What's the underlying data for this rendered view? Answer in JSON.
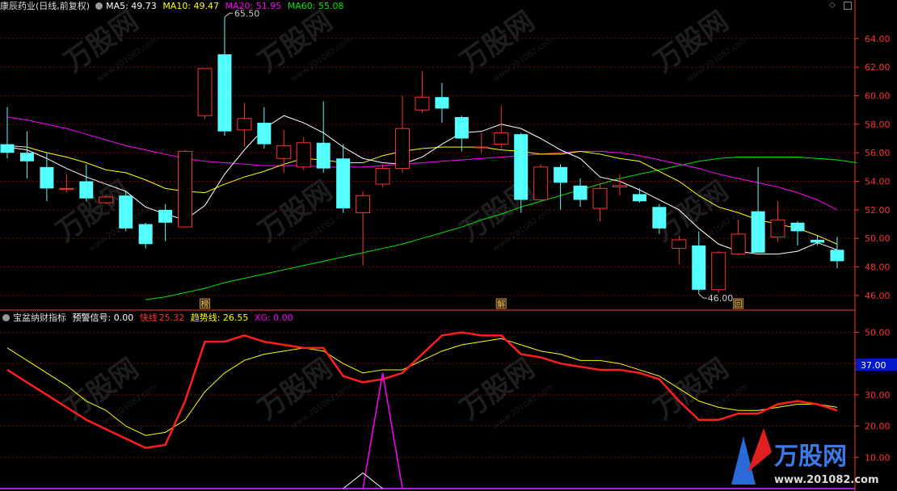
{
  "header": {
    "stock": "康辰药业(日线,前复权)",
    "ma5": "MA5: 49.73",
    "ma10": "MA10: 49.47",
    "ma20": "MA20: 51.95",
    "ma60": "MA60: 55.08"
  },
  "indicator_header": {
    "name": "宝盆纳财指标",
    "warn": "预警信号: 0.00",
    "fast_label": "快线",
    "fast_value": "25.32",
    "trend": "趋势线: 26.55",
    "xg": "XG: 0.00"
  },
  "colors": {
    "up": "#ff3232",
    "down": "#54ffff",
    "ma5": "#ffffff",
    "ma10": "#ffff00",
    "ma20": "#ff00ff",
    "ma60": "#00e600",
    "grid": "#8b0000",
    "axis": "#ff3232"
  },
  "markers": {
    "high_label": "65.50",
    "low_label": "46.00",
    "bang": "榜",
    "jie": "解",
    "hui": "回"
  },
  "watermark": {
    "text": "万股网",
    "url": "www.201082.com"
  },
  "chart_data": [
    {
      "type": "candlestick",
      "yticks": [
        46,
        48,
        50,
        52,
        54,
        56,
        58,
        60,
        62,
        64
      ],
      "ytick_labels": [
        "46.00",
        "48.00",
        "50.00",
        "52.00",
        "54.00",
        "56.00",
        "58.00",
        "60.00",
        "62.00",
        "64.00"
      ],
      "ylim": [
        45.2,
        65.8
      ],
      "candles": [
        {
          "o": 56.6,
          "c": 56.0,
          "h": 59.2,
          "l": 55.6
        },
        {
          "o": 56.0,
          "c": 55.4,
          "h": 57.5,
          "l": 54.2
        },
        {
          "o": 55.0,
          "c": 53.5,
          "h": 56.0,
          "l": 52.6
        },
        {
          "o": 53.5,
          "c": 53.5,
          "h": 54.5,
          "l": 53.2
        },
        {
          "o": 54.0,
          "c": 52.8,
          "h": 55.2,
          "l": 52.6
        },
        {
          "o": 52.5,
          "c": 52.9,
          "h": 53.0,
          "l": 52.4
        },
        {
          "o": 53.0,
          "c": 50.7,
          "h": 53.3,
          "l": 50.5
        },
        {
          "o": 51.0,
          "c": 49.6,
          "h": 51.1,
          "l": 49.3
        },
        {
          "o": 52.0,
          "c": 51.1,
          "h": 52.4,
          "l": 49.8
        },
        {
          "o": 50.8,
          "c": 56.1,
          "h": 56.2,
          "l": 50.8
        },
        {
          "o": 58.6,
          "c": 61.9,
          "h": 61.9,
          "l": 58.4
        },
        {
          "o": 62.9,
          "c": 57.5,
          "h": 65.5,
          "l": 57.2
        },
        {
          "o": 57.6,
          "c": 58.4,
          "h": 59.5,
          "l": 56.4
        },
        {
          "o": 58.1,
          "c": 56.6,
          "h": 59.2,
          "l": 56.3
        },
        {
          "o": 55.6,
          "c": 56.5,
          "h": 57.6,
          "l": 54.6
        },
        {
          "o": 55.0,
          "c": 56.7,
          "h": 57.1,
          "l": 54.8
        },
        {
          "o": 56.7,
          "c": 54.9,
          "h": 59.6,
          "l": 54.6
        },
        {
          "o": 55.6,
          "c": 52.1,
          "h": 56.6,
          "l": 51.8
        },
        {
          "o": 51.8,
          "c": 53.0,
          "h": 53.3,
          "l": 48.1
        },
        {
          "o": 53.8,
          "c": 54.9,
          "h": 55.2,
          "l": 53.6
        },
        {
          "o": 54.9,
          "c": 57.7,
          "h": 60.0,
          "l": 54.6
        },
        {
          "o": 59.0,
          "c": 59.9,
          "h": 61.7,
          "l": 58.8
        },
        {
          "o": 59.9,
          "c": 59.1,
          "h": 60.9,
          "l": 58.1
        },
        {
          "o": 58.5,
          "c": 57.0,
          "h": 58.6,
          "l": 56.1
        },
        {
          "o": 56.4,
          "c": 56.4,
          "h": 57.4,
          "l": 56.0
        },
        {
          "o": 56.6,
          "c": 57.4,
          "h": 59.3,
          "l": 56.3
        },
        {
          "o": 57.3,
          "c": 52.7,
          "h": 57.4,
          "l": 51.8
        },
        {
          "o": 52.7,
          "c": 55.0,
          "h": 55.2,
          "l": 52.6
        },
        {
          "o": 55.0,
          "c": 53.9,
          "h": 55.2,
          "l": 52.0
        },
        {
          "o": 53.7,
          "c": 52.7,
          "h": 54.2,
          "l": 52.2
        },
        {
          "o": 52.1,
          "c": 53.5,
          "h": 53.9,
          "l": 51.2
        },
        {
          "o": 53.6,
          "c": 53.7,
          "h": 54.5,
          "l": 53.0
        },
        {
          "o": 53.1,
          "c": 52.6,
          "h": 53.5,
          "l": 52.5
        },
        {
          "o": 52.2,
          "c": 50.7,
          "h": 52.4,
          "l": 50.3
        },
        {
          "o": 49.3,
          "c": 49.9,
          "h": 50.2,
          "l": 48.2
        },
        {
          "o": 49.5,
          "c": 46.4,
          "h": 50.5,
          "l": 46.1
        },
        {
          "o": 46.4,
          "c": 49.0,
          "h": 49.1,
          "l": 46.2
        },
        {
          "o": 48.9,
          "c": 50.3,
          "h": 51.3,
          "l": 48.8
        },
        {
          "o": 51.9,
          "c": 49.0,
          "h": 55.0,
          "l": 49.0
        },
        {
          "o": 50.1,
          "c": 51.3,
          "h": 52.6,
          "l": 49.8
        },
        {
          "o": 51.1,
          "c": 50.5,
          "h": 51.2,
          "l": 49.5
        },
        {
          "o": 49.9,
          "c": 49.7,
          "h": 50.2,
          "l": 49.5
        },
        {
          "o": 49.2,
          "c": 48.4,
          "h": 50.1,
          "l": 47.9
        }
      ],
      "ma5": [
        56.4,
        56.2,
        55.6,
        54.9,
        54.3,
        53.8,
        53.3,
        52.2,
        51.7,
        51.3,
        52.3,
        54.5,
        56.2,
        57.7,
        58.6,
        58.1,
        57.4,
        56.4,
        55.6,
        55.3,
        55.2,
        55.7,
        56.6,
        57.4,
        57.5,
        58.0,
        57.7,
        57.0,
        56.2,
        55.6,
        54.3,
        54.0,
        53.4,
        52.7,
        52.0,
        50.7,
        49.6,
        49.1,
        48.9,
        48.9,
        49.1,
        49.7,
        49.2
      ],
      "ma10": [
        56.5,
        56.4,
        56.0,
        55.7,
        55.3,
        54.8,
        54.6,
        54.1,
        53.5,
        53.3,
        53.2,
        53.8,
        54.3,
        54.7,
        55.2,
        55.6,
        55.5,
        55.3,
        55.3,
        55.8,
        56.1,
        56.3,
        56.4,
        56.4,
        56.4,
        56.2,
        56.1,
        55.9,
        55.9,
        56.1,
        55.9,
        55.6,
        55.4,
        54.7,
        54.0,
        53.0,
        52.2,
        51.8,
        51.3,
        51.0,
        50.7,
        50.2,
        49.6
      ],
      "ma20": [
        58.5,
        58.3,
        58.0,
        57.7,
        57.3,
        56.9,
        56.5,
        56.2,
        55.9,
        55.6,
        55.4,
        55.3,
        55.2,
        55.1,
        55.1,
        55.1,
        55.0,
        55.0,
        55.0,
        55.1,
        55.2,
        55.3,
        55.4,
        55.5,
        55.6,
        55.7,
        55.8,
        55.9,
        56.0,
        56.1,
        56.1,
        56.0,
        55.8,
        55.5,
        55.2,
        54.9,
        54.5,
        54.2,
        53.9,
        53.6,
        53.2,
        52.7,
        52.0
      ],
      "ma60_start_index": 7,
      "ma60": [
        45.7,
        45.9,
        46.2,
        46.5,
        46.9,
        47.2,
        47.5,
        47.8,
        48.1,
        48.4,
        48.7,
        49.0,
        49.3,
        49.6,
        50.0,
        50.4,
        50.8,
        51.3,
        51.7,
        52.2,
        52.6,
        53.0,
        53.4,
        53.8,
        54.2,
        54.5,
        54.8,
        55.1,
        55.4,
        55.6,
        55.7,
        55.7,
        55.7,
        55.7,
        55.6,
        55.5,
        55.3
      ]
    },
    {
      "type": "line",
      "title": "宝盆纳财指标",
      "yticks": [
        10,
        20,
        30,
        40,
        50
      ],
      "ytick_labels": [
        "10.00",
        "20.00",
        "30.00",
        "40.00",
        "50.00"
      ],
      "current_tag": "37.00",
      "ylim": [
        0,
        52
      ],
      "series": [
        {
          "name": "快线",
          "values": [
            38,
            34,
            30,
            26,
            22,
            19,
            16,
            13,
            14,
            28,
            47,
            47,
            49,
            47,
            46,
            45,
            45,
            36,
            34,
            35,
            37,
            43,
            49,
            50,
            49,
            49,
            43,
            42,
            40,
            39,
            38,
            38,
            37,
            35,
            28,
            22,
            22,
            24,
            24,
            27,
            28,
            27,
            25
          ]
        },
        {
          "name": "趋势线",
          "values": [
            45,
            41,
            37,
            33,
            28,
            25,
            20,
            17,
            18,
            22,
            31,
            37,
            41,
            43,
            44,
            45,
            44,
            40,
            37,
            38,
            38,
            41,
            44,
            46,
            47,
            48,
            46,
            44,
            43,
            41,
            41,
            40,
            38,
            36,
            32,
            28,
            26,
            25,
            25,
            26,
            27,
            27,
            26
          ]
        },
        {
          "name": "预警信号",
          "values": [
            0,
            0,
            0,
            0,
            0,
            0,
            0,
            0,
            0,
            0,
            0,
            0,
            0,
            0,
            0,
            0,
            0,
            0,
            0,
            0,
            0,
            0,
            0,
            0,
            0,
            0,
            0,
            0,
            0,
            0,
            0,
            0,
            0,
            0,
            0,
            0,
            0,
            0,
            0,
            0,
            0,
            0,
            0
          ]
        },
        {
          "name": "XG",
          "values": [
            0,
            0,
            0,
            0,
            0,
            0,
            0,
            0,
            0,
            0,
            0,
            0,
            0,
            0,
            0,
            0,
            0,
            0,
            0,
            37,
            0,
            0,
            0,
            0,
            0,
            0,
            0,
            0,
            0,
            0,
            0,
            0,
            0,
            0,
            0,
            0,
            0,
            0,
            0,
            0,
            0,
            0,
            0
          ]
        }
      ]
    }
  ]
}
